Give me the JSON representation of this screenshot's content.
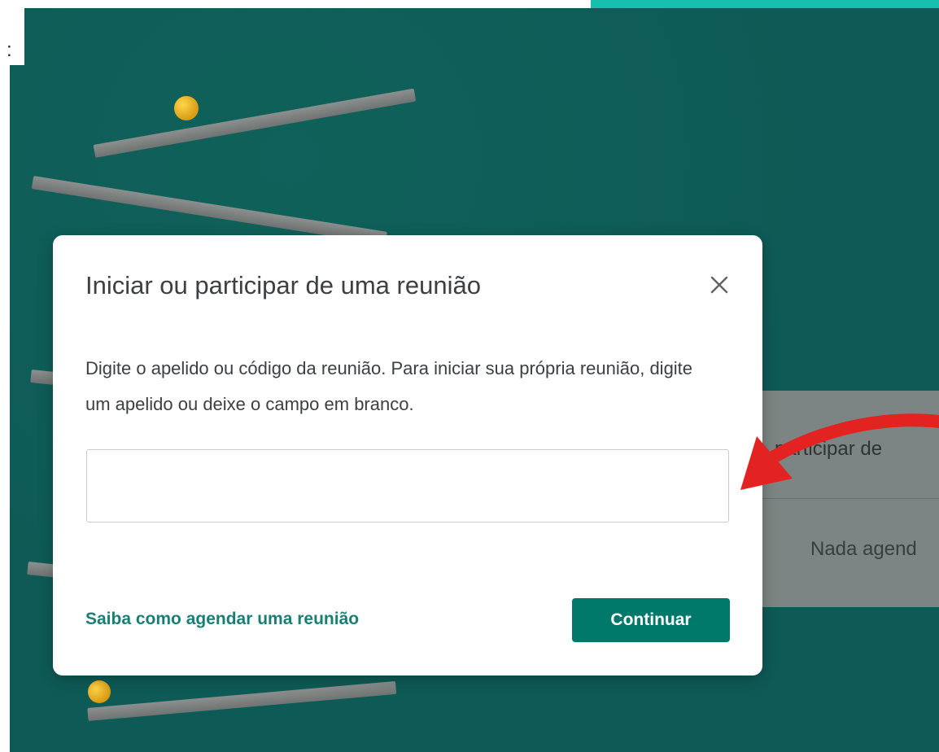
{
  "background": {
    "corner_text": ":",
    "card_text_1": "participar de",
    "card_text_2": "Nada agend",
    "accent_color": "#16bfae",
    "backdrop_color": "#0e5a56"
  },
  "dialog": {
    "title": "Iniciar ou participar de uma reunião",
    "description": "Digite o apelido ou código da reunião. Para iniciar sua própria reunião, digite um apelido ou deixe o campo em branco.",
    "input_value": "",
    "input_placeholder": "",
    "learn_link": "Saiba como agendar uma reunião",
    "continue_label": "Continuar",
    "close_icon": "close-icon",
    "button_color": "#00796b",
    "link_color": "#1a7f73"
  },
  "annotation": {
    "arrow_icon": "red-arrow-icon",
    "arrow_color": "#e32222"
  }
}
